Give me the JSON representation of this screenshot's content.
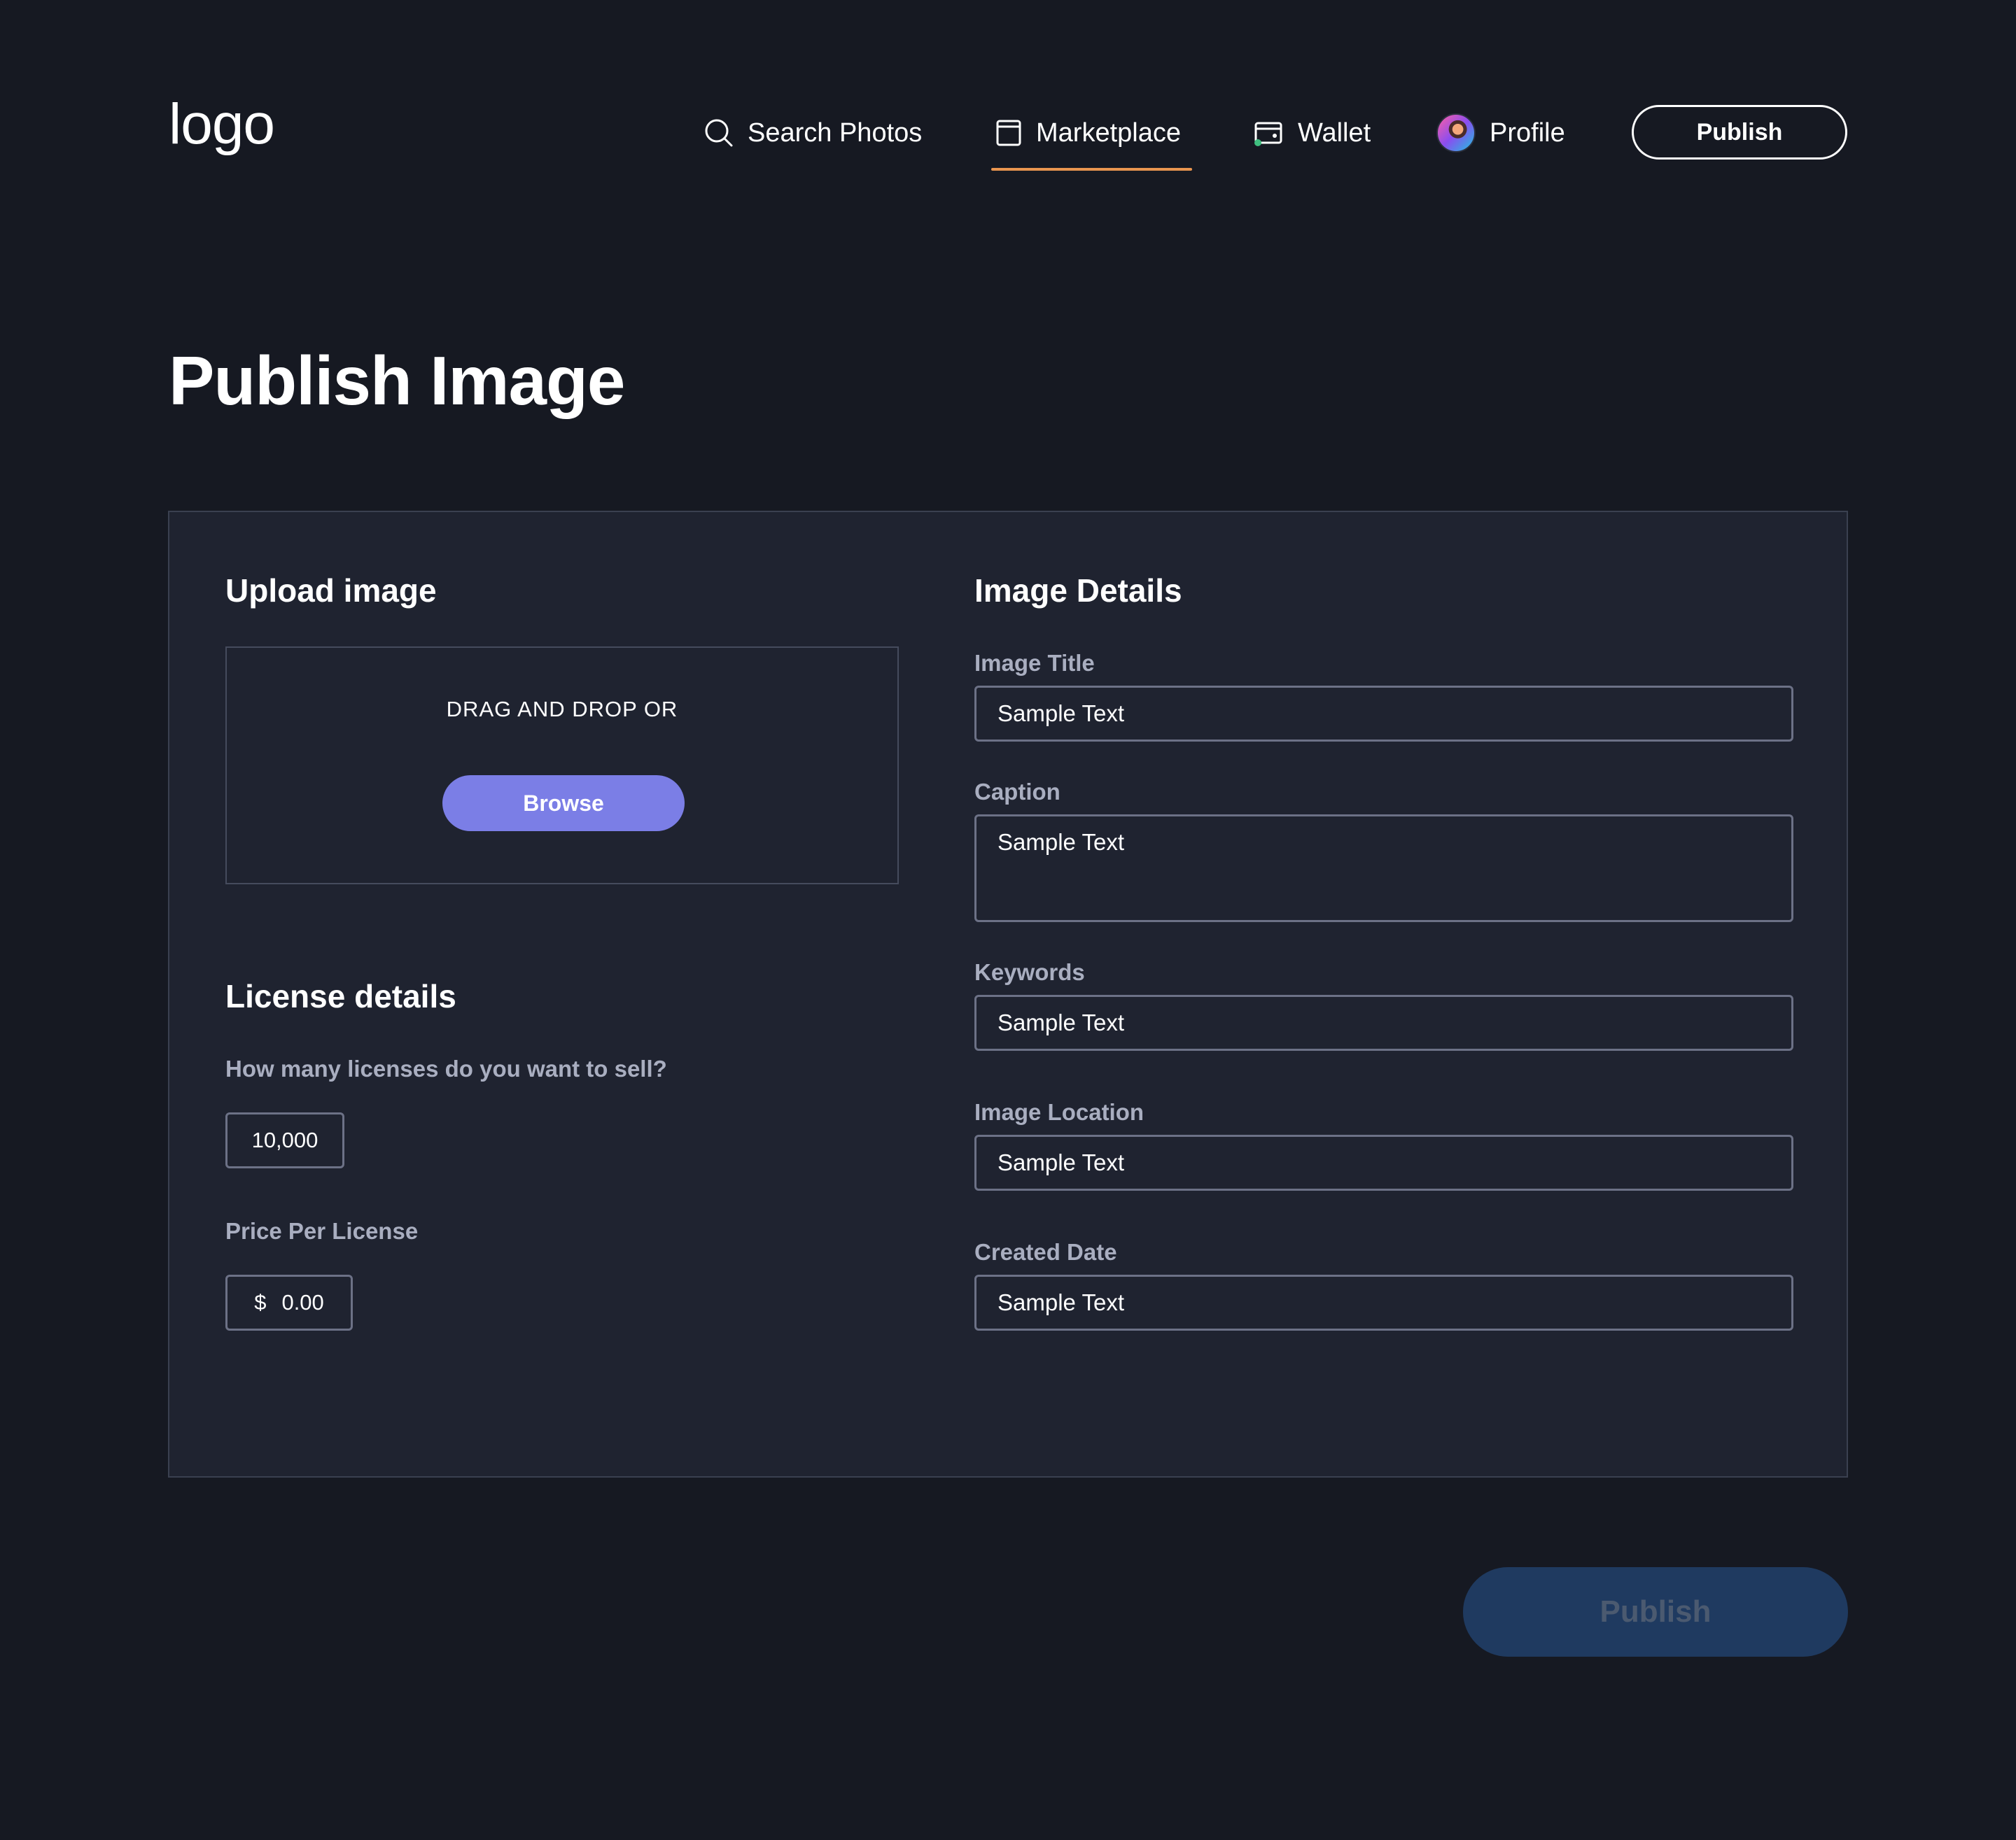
{
  "header": {
    "logo": "logo",
    "nav": [
      {
        "label": "Search Photos",
        "icon": "search-icon"
      },
      {
        "label": "Marketplace",
        "icon": "marketplace-icon",
        "active": true
      },
      {
        "label": "Wallet",
        "icon": "wallet-icon"
      },
      {
        "label": "Profile",
        "icon": "avatar"
      }
    ],
    "publish_button": "Publish",
    "accent_color": "#e9954f"
  },
  "page": {
    "title": "Publish Image"
  },
  "upload": {
    "title": "Upload image",
    "drop_text": "DRAG AND DROP OR",
    "browse_button": "Browse",
    "browse_color": "#7b7ee6"
  },
  "license": {
    "title": "License details",
    "quantity_label": "How many licenses do you want to sell?",
    "quantity_value": "10,000",
    "price_label": "Price Per License",
    "price_currency": "$",
    "price_value": "0.00"
  },
  "details": {
    "title": "Image Details",
    "fields": [
      {
        "label": "Image Title",
        "value": "Sample Text"
      },
      {
        "label": "Caption",
        "value": "Sample Text"
      },
      {
        "label": "Keywords",
        "value": "Sample Text"
      },
      {
        "label": "Image Location",
        "value": "Sample Text"
      },
      {
        "label": "Created Date",
        "value": "Sample Text"
      }
    ]
  },
  "footer": {
    "publish_button": "Publish",
    "publish_disabled": true
  }
}
